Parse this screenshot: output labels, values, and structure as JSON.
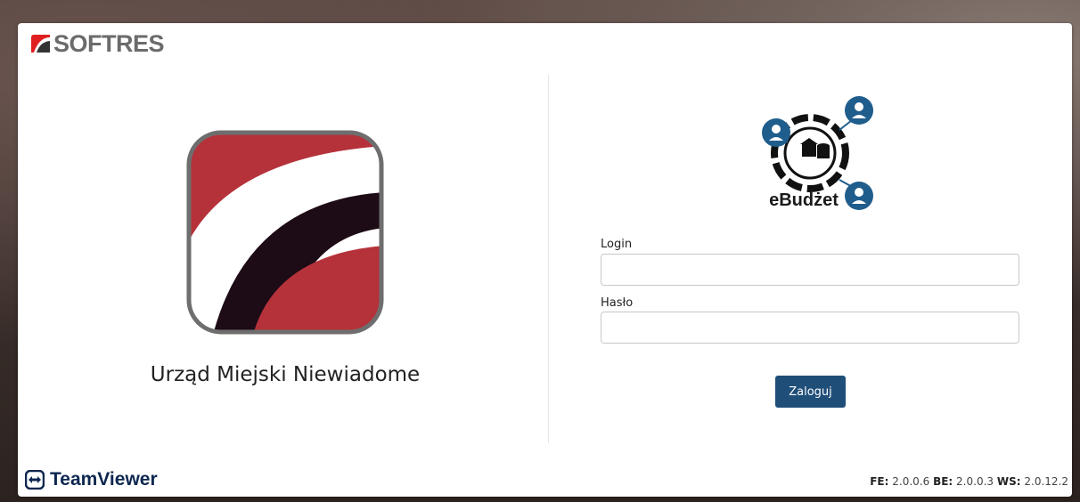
{
  "brand": {
    "name": "SOFTRES",
    "icon": "softres-logo-icon"
  },
  "organization": {
    "name": "Urząd Miejski Niewiadome",
    "logo": "organization-logo"
  },
  "app": {
    "name": "eBudżet",
    "logo": "ebudzet-logo"
  },
  "form": {
    "login_label": "Login",
    "login_value": "",
    "password_label": "Hasło",
    "password_value": "",
    "submit_label": "Zaloguj"
  },
  "teamviewer": {
    "name": "TeamViewer",
    "icon": "teamviewer-icon"
  },
  "version": {
    "fe_label": "FE:",
    "fe_value": "2.0.0.6",
    "be_label": "BE:",
    "be_value": "2.0.0.3",
    "ws_label": "WS:",
    "ws_value": "2.0.12.2"
  },
  "colors": {
    "primary_button": "#1f4e79",
    "app_blue": "#1f5d8c",
    "org_red": "#b5323a",
    "org_dark": "#1d0b16"
  }
}
